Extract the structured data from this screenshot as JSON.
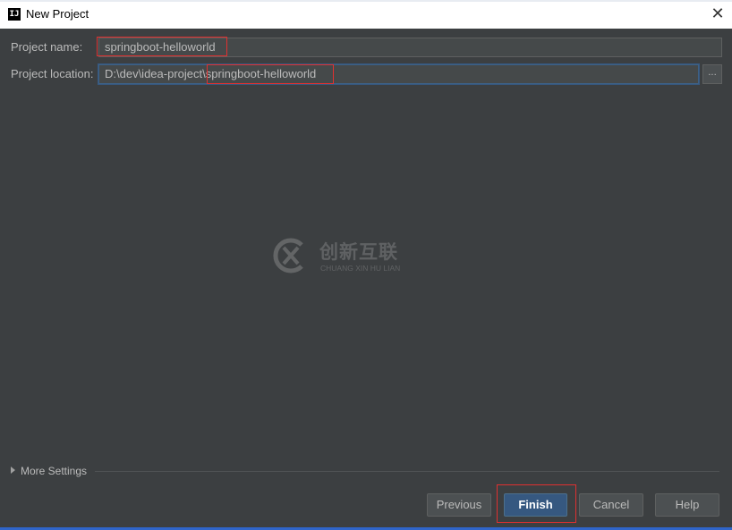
{
  "window": {
    "title": "New Project",
    "app_icon_text": "IJ",
    "close_glyph": "✕"
  },
  "form": {
    "project_name_label": "Project name:",
    "project_name_value": "springboot-helloworld",
    "project_location_label": "Project location:",
    "project_location_value": "D:\\dev\\idea-project\\springboot-helloworld",
    "browse_label": "..."
  },
  "watermark": {
    "chinese_text": "创新互联",
    "english_text": "CHUANG XIN HU LIAN"
  },
  "more_settings": {
    "label": "More Settings"
  },
  "buttons": {
    "previous": "Previous",
    "finish": "Finish",
    "cancel": "Cancel",
    "help": "Help"
  },
  "colors": {
    "background": "#3c3f41",
    "field_background": "#45494a",
    "primary_button": "#365880",
    "highlight_box": "#e03030"
  }
}
